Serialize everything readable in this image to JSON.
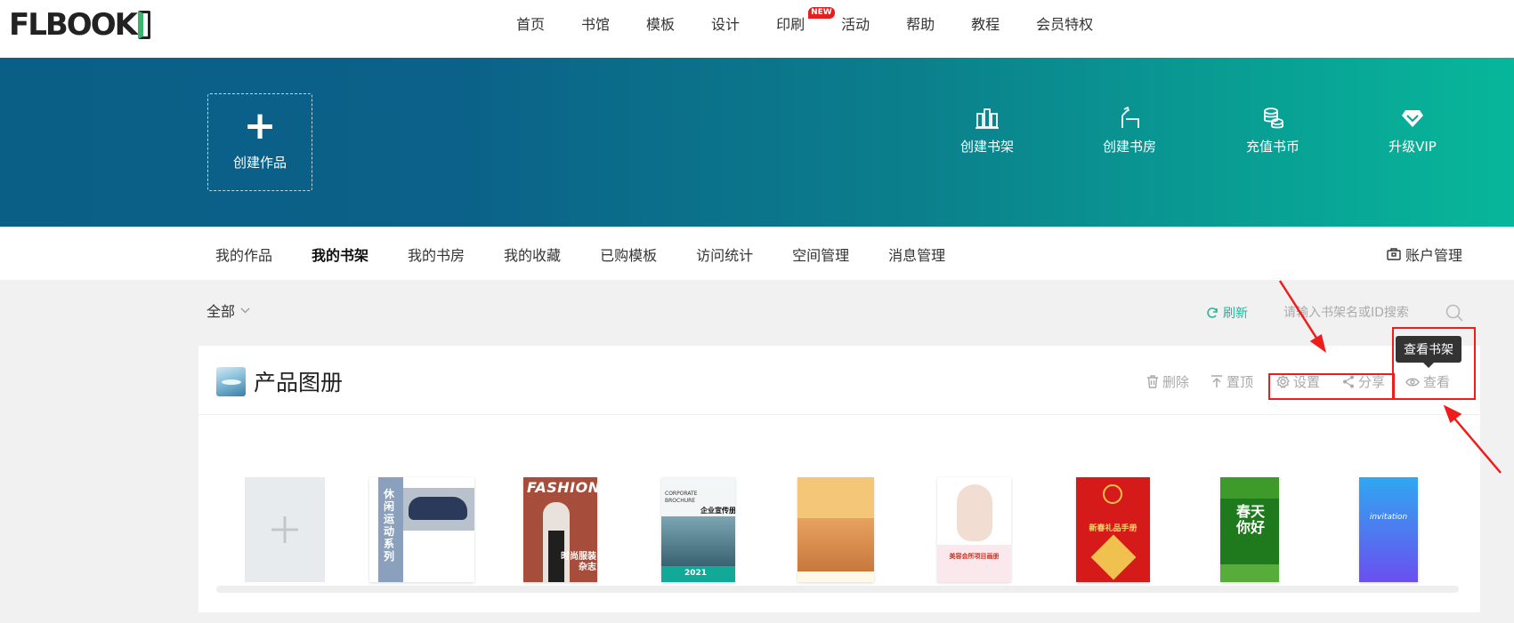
{
  "logo": {
    "text": "FLBOOK"
  },
  "nav": {
    "items": [
      "首页",
      "书馆",
      "模板",
      "设计",
      "印刷",
      "活动",
      "帮助",
      "教程",
      "会员特权"
    ],
    "new_badge": "NEW"
  },
  "banner": {
    "create_label": "创建作品",
    "actions": [
      {
        "label": "创建书架",
        "icon": "shelf-icon"
      },
      {
        "label": "创建书房",
        "icon": "study-room-icon"
      },
      {
        "label": "充值书币",
        "icon": "coins-icon"
      },
      {
        "label": "升级VIP",
        "icon": "diamond-icon"
      }
    ]
  },
  "subnav": {
    "tabs": [
      "我的作品",
      "我的书架",
      "我的书房",
      "我的收藏",
      "已购模板",
      "访问统计",
      "空间管理",
      "消息管理"
    ],
    "active": "我的书架",
    "account": "账户管理"
  },
  "toolbar": {
    "filter": "全部",
    "refresh": "刷新",
    "search_placeholder": "请输入书架名或ID搜索"
  },
  "shelf": {
    "title": "产品图册",
    "actions": {
      "delete": "删除",
      "top": "置顶",
      "settings": "设置",
      "share": "分享",
      "view": "查看"
    },
    "tooltip": "查看书架",
    "books": [
      {
        "title": "休闲运动系列"
      },
      {
        "title": "FASHION",
        "subtitle": "时尚服装杂志"
      },
      {
        "title": "CORPORATE BROCHURE",
        "subtitle": "企业宣传册",
        "year": "2021"
      },
      {
        "title": ""
      },
      {
        "title": "美容会所项目画册"
      },
      {
        "title": "新春礼品手册"
      },
      {
        "title": "春天你好"
      },
      {
        "title": "invitation"
      }
    ]
  },
  "colors": {
    "accent": "#1fb89a",
    "annotation": "#f01c1c",
    "banner_start": "#0a5f86",
    "banner_end": "#07b79a"
  }
}
